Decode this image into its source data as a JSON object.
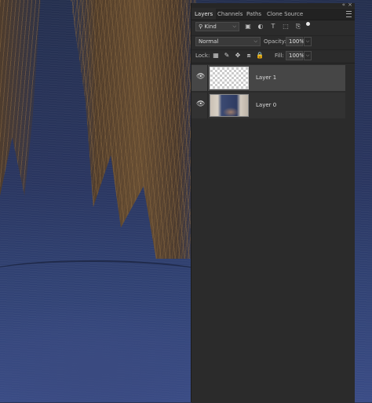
{
  "panel": {
    "tabs": [
      "Layers",
      "Channels",
      "Paths",
      "Clone Source"
    ],
    "active_tab": 0,
    "collapse_icon": "double-chevron",
    "close_icon": "close"
  },
  "filter": {
    "kind_label": "Kind",
    "search_icon": "search-icon",
    "icons": [
      "pixel-filter-icon",
      "adjustment-filter-icon",
      "type-filter-icon",
      "shape-filter-icon",
      "smart-object-filter-icon"
    ]
  },
  "blend": {
    "mode": "Normal",
    "opacity_label": "Opacity:",
    "opacity_value": "100%"
  },
  "lock": {
    "label": "Lock:",
    "icons": [
      "lock-transparent-icon",
      "lock-image-icon",
      "lock-position-icon",
      "lock-artboard-icon",
      "lock-all-icon"
    ],
    "fill_label": "Fill:",
    "fill_value": "100%"
  },
  "layers": [
    {
      "name": "Layer 1",
      "visible": true,
      "selected": true,
      "thumbnail": "transparent"
    },
    {
      "name": "Layer 0",
      "visible": true,
      "selected": false,
      "thumbnail": "photo"
    }
  ]
}
